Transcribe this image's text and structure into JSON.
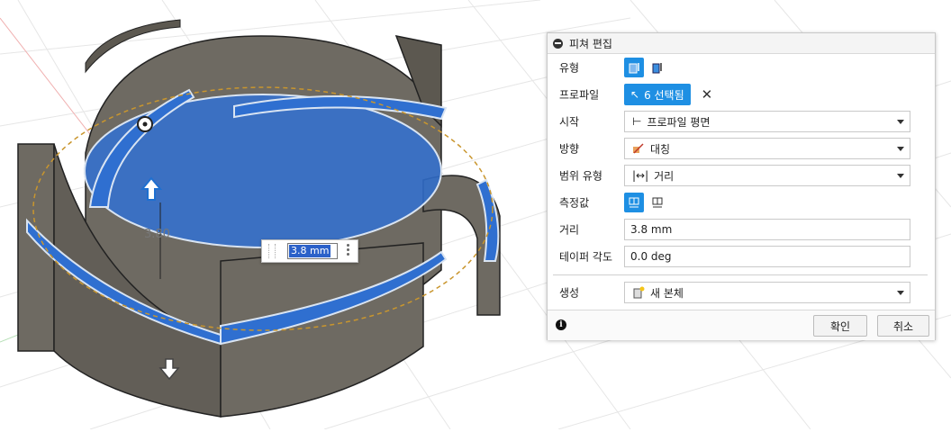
{
  "viewport": {
    "dimension_label": "3.80",
    "dimension_input_value": "3.8 mm"
  },
  "panel": {
    "title": "피쳐 편집",
    "rows": {
      "type_label": "유형",
      "profile_label": "프로파일",
      "profile_selection": "6 선택됨",
      "start_label": "시작",
      "start_value": "프로파일 평면",
      "direction_label": "방향",
      "direction_value": "대칭",
      "extent_type_label": "범위 유형",
      "extent_type_value": "거리",
      "measure_label": "측정값",
      "distance_label": "거리",
      "distance_value": "3.8 mm",
      "taper_label": "테이퍼 각도",
      "taper_value": "0.0 deg",
      "operation_label": "생성",
      "operation_value": "새 본체"
    },
    "ok_label": "확인",
    "cancel_label": "취소"
  },
  "colors": {
    "accent": "#1e8fe3",
    "selection_blue": "#2f6fd0",
    "body_gray": "#6e6a62"
  },
  "icons": [
    "collapse-icon",
    "extrude-icon",
    "thin-extrude-icon",
    "cursor-icon",
    "close-icon",
    "start-plane-icon",
    "symmetric-icon",
    "distance-icon",
    "half-length-icon",
    "whole-length-icon",
    "new-body-icon",
    "info-icon",
    "up-arrow-icon",
    "down-arrow-icon"
  ]
}
